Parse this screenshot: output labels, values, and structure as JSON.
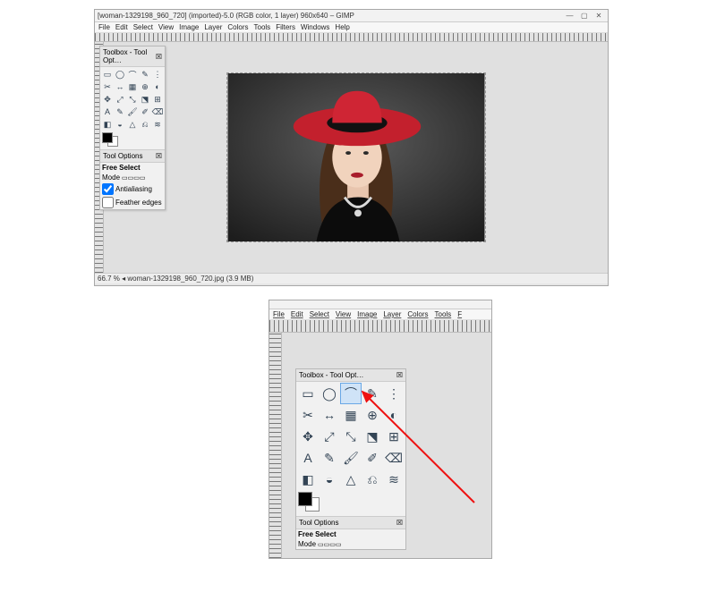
{
  "app": {
    "title": "[woman-1329198_960_720] (imported)-5.0 (RGB color, 1 layer) 960x640 – GIMP",
    "window_controls": {
      "min": "—",
      "max": "▢",
      "close": "✕"
    }
  },
  "menu": {
    "file": "File",
    "edit": "Edit",
    "select": "Select",
    "view": "View",
    "image": "Image",
    "layer": "Layer",
    "colors": "Colors",
    "tools": "Tools",
    "filters": "Filters",
    "windows": "Windows",
    "help": "Help"
  },
  "toolbox": {
    "title": "Toolbox - Tool Opt…",
    "close": "☒",
    "tools": [
      "▭",
      "◯",
      "⌒",
      "✎",
      "⋮",
      "✂",
      "↔",
      "▦",
      "⊕",
      "◐",
      "✥",
      "⤢",
      "⤡",
      "⬔",
      "⊞",
      "A",
      "✎",
      "🖌",
      "✐",
      "⌫",
      "◧",
      "◒",
      "△",
      "⎌",
      "≋"
    ],
    "fg": "#000000",
    "bg": "#ffffff"
  },
  "toolopts": {
    "header": "Tool Options",
    "tool": "Free Select",
    "mode": "Mode",
    "antialias": "Antialiasing",
    "feather": "Feather edges"
  },
  "status": "66.7 % ◂ woman-1329198_960_720.jpg (3.9 MB)",
  "zoom_close": {
    "menu_short": {
      "file": "File",
      "edit": "Edit",
      "select": "Select",
      "view": "View",
      "image": "Image",
      "layer": "Layer",
      "colors": "Colors",
      "tools": "Tools",
      "f": "F"
    }
  }
}
